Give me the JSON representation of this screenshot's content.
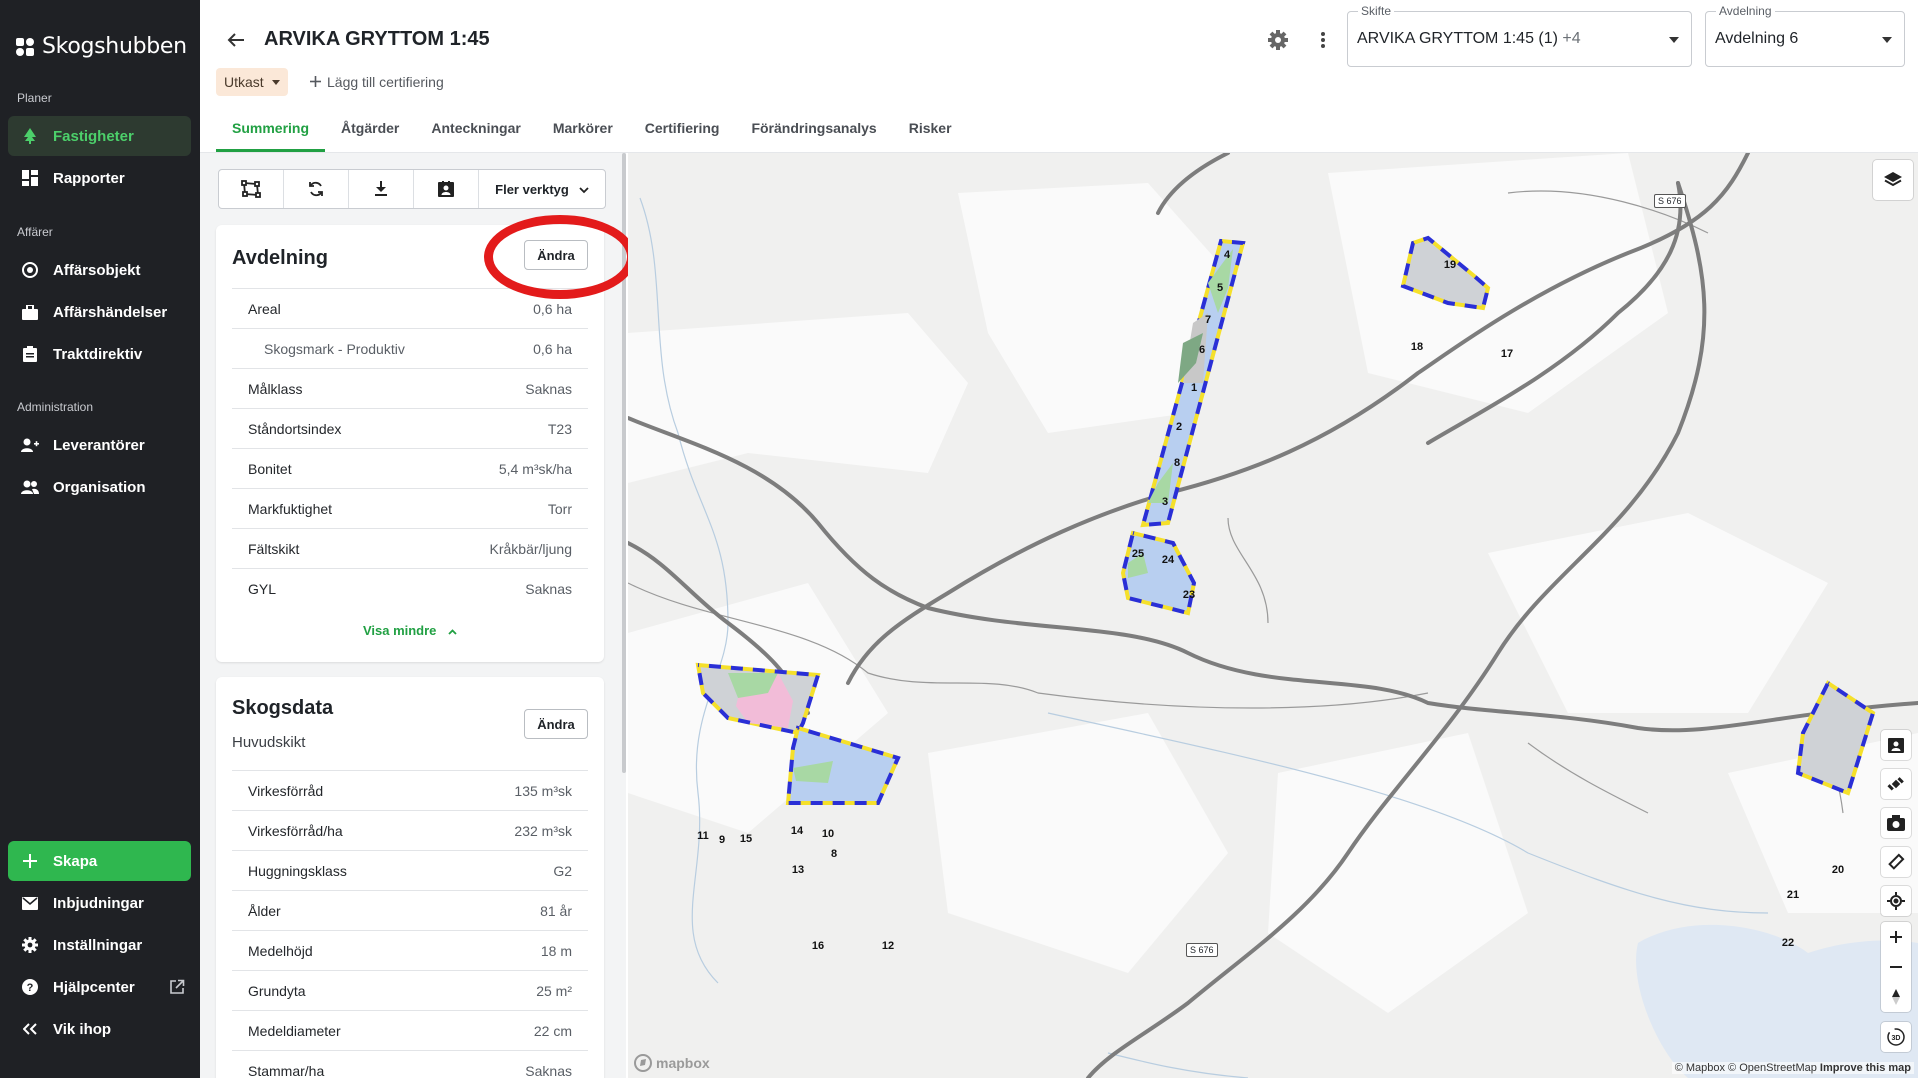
{
  "sidebar": {
    "brand": "Skogshubben",
    "sections": {
      "planer": "Planer",
      "affarer": "Affärer",
      "administration": "Administration"
    },
    "items": {
      "fastigheter": "Fastigheter",
      "rapporter": "Rapporter",
      "affarsobjekt": "Affärsobjekt",
      "affarshandelser": "Affärshändelser",
      "traktdirektiv": "Traktdirektiv",
      "leverantorer": "Leverantörer",
      "organisation": "Organisation",
      "skapa": "Skapa",
      "inbjudningar": "Inbjudningar",
      "installningar": "Inställningar",
      "hjalpcenter": "Hjälpcenter",
      "vik_ihop": "Vik ihop"
    }
  },
  "header": {
    "title": "ARVIKA GRYTTOM 1:45",
    "status": "Utkast",
    "add_cert": "Lägg till certifiering",
    "skifte": {
      "label": "Skifte",
      "value": "ARVIKA GRYTTOM 1:45 (1)",
      "extra": "+4"
    },
    "avdelning": {
      "label": "Avdelning",
      "value": "Avdelning 6"
    }
  },
  "tabs": [
    "Summering",
    "Åtgärder",
    "Anteckningar",
    "Markörer",
    "Certifiering",
    "Förändringsanalys",
    "Risker"
  ],
  "toolbar": {
    "more": "Fler verktyg"
  },
  "avdelning_card": {
    "title": "Avdelning",
    "edit": "Ändra",
    "rows": [
      {
        "k": "Areal",
        "v": "0,6 ha"
      },
      {
        "k": "Skogsmark - Produktiv",
        "v": "0,6 ha"
      },
      {
        "k": "Målklass",
        "v": "Saknas"
      },
      {
        "k": "Ståndortsindex",
        "v": "T23"
      },
      {
        "k": "Bonitet",
        "v": "5,4 m³sk/ha"
      },
      {
        "k": "Markfuktighet",
        "v": "Torr"
      },
      {
        "k": "Fältskikt",
        "v": "Kråkbär/ljung"
      },
      {
        "k": "GYL",
        "v": "Saknas"
      }
    ],
    "show_less": "Visa mindre"
  },
  "skogsdata_card": {
    "title": "Skogsdata",
    "subtitle": "Huvudskikt",
    "edit": "Ändra",
    "rows": [
      {
        "k": "Virkesförråd",
        "v": "135 m³sk"
      },
      {
        "k": "Virkesförråd/ha",
        "v": "232 m³sk"
      },
      {
        "k": "Huggningsklass",
        "v": "G2"
      },
      {
        "k": "Ålder",
        "v": "81 år"
      },
      {
        "k": "Medelhöjd",
        "v": "18 m"
      },
      {
        "k": "Grundyta",
        "v": "25 m²"
      },
      {
        "k": "Medeldiameter",
        "v": "22 cm"
      },
      {
        "k": "Stammar/ha",
        "v": "Saknas"
      }
    ]
  },
  "map": {
    "road_labels": [
      "S 676",
      "S 676"
    ],
    "stand_numbers": [
      "4",
      "5",
      "7",
      "6",
      "1",
      "2",
      "8",
      "3",
      "25",
      "24",
      "23",
      "19",
      "18",
      "17",
      "11",
      "9",
      "15",
      "14",
      "10",
      "8",
      "13",
      "16",
      "12",
      "20",
      "21",
      "22"
    ],
    "attribution": "© Mapbox © OpenStreetMap",
    "improve": "Improve this map",
    "logo": "mapbox"
  },
  "colors": {
    "accent": "#21a043",
    "sidebar_bg": "#1f2125",
    "stand_border_blue": "#2a2fd6",
    "stand_border_yellow": "#f5e02b",
    "highlight_ring": "#e31b1b"
  }
}
